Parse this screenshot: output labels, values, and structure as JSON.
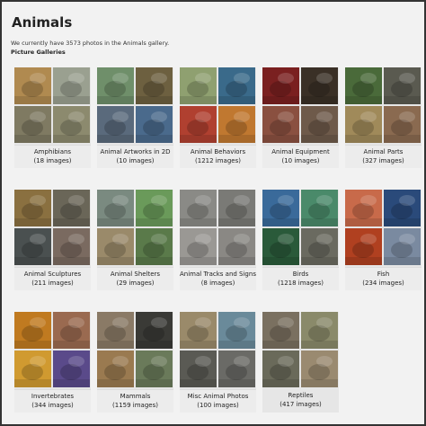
{
  "page": {
    "title": "Animals",
    "intro": "We currently have 3573 photos in the Animals gallery.",
    "section_label": "Picture Galleries"
  },
  "galleries": [
    {
      "name": "Amphibians",
      "count": "(18 images)",
      "colors": [
        "#b08a50",
        "#9aa090",
        "#7f7a62",
        "#8c8a6e"
      ],
      "icons": [
        "frog-photo",
        "frog-photo",
        "frog-photo",
        "frog-photo"
      ]
    },
    {
      "name": "Animal Artworks in 2D",
      "count": "(10 images)",
      "colors": [
        "#6f8f6a",
        "#6d6040",
        "#5a6a7c",
        "#4a6a8c"
      ],
      "icons": [
        "art-photo",
        "art-photo",
        "art-photo",
        "art-photo"
      ]
    },
    {
      "name": "Animal Behaviors",
      "count": "(1212 images)",
      "colors": [
        "#8fa070",
        "#3a6a8a",
        "#b04030",
        "#c07830"
      ],
      "icons": [
        "animal-photo",
        "animal-photo",
        "animal-photo",
        "animal-photo"
      ]
    },
    {
      "name": "Animal Equipment",
      "count": "(10 images)",
      "colors": [
        "#7a2020",
        "#3a3026",
        "#8a5040",
        "#6e5a4a"
      ],
      "icons": [
        "equipment-photo",
        "equipment-photo",
        "equipment-photo",
        "equipment-photo"
      ]
    },
    {
      "name": "Animal Parts",
      "count": "(327 images)",
      "colors": [
        "#4a6a3a",
        "#5a5a50",
        "#a08a5a",
        "#8a6a50"
      ],
      "icons": [
        "animal-photo",
        "animal-photo",
        "animal-photo",
        "animal-photo"
      ]
    },
    {
      "name": "Animal Sculptures",
      "count": "(211 images)",
      "colors": [
        "#8a7040",
        "#6a6658",
        "#4a5050",
        "#7a6a60"
      ],
      "icons": [
        "sculpture-photo",
        "sculpture-photo",
        "sculpture-photo",
        "sculpture-photo"
      ]
    },
    {
      "name": "Animal Shelters",
      "count": "(29 images)",
      "colors": [
        "#7a8a80",
        "#6a9a5a",
        "#9a8a6a",
        "#5a7a4a"
      ],
      "icons": [
        "shelter-photo",
        "shelter-photo",
        "shelter-photo",
        "shelter-photo"
      ]
    },
    {
      "name": "Animal Tracks and Signs",
      "count": "(8 images)",
      "colors": [
        "#8a8a86",
        "#7a7a76",
        "#9a9894",
        "#8a8884"
      ],
      "icons": [
        "tracks-photo",
        "tracks-photo",
        "tracks-photo",
        "tracks-photo"
      ]
    },
    {
      "name": "Birds",
      "count": "(1218 images)",
      "colors": [
        "#3a6a9a",
        "#4a8a6a",
        "#2a5a3a",
        "#6a6a60"
      ],
      "icons": [
        "bird-photo",
        "bird-photo",
        "bird-photo",
        "bird-photo"
      ]
    },
    {
      "name": "Fish",
      "count": "(234 images)",
      "colors": [
        "#c86a4a",
        "#2a4a7a",
        "#b04020",
        "#7a8aa0"
      ],
      "icons": [
        "fish-photo",
        "fish-photo",
        "fish-photo",
        "fish-photo"
      ]
    },
    {
      "name": "Invertebrates",
      "count": "(344 images)",
      "colors": [
        "#c07a20",
        "#9a6a50",
        "#d09a30",
        "#5a4a8a"
      ],
      "icons": [
        "bug-photo",
        "bug-photo",
        "bug-photo",
        "bug-photo"
      ]
    },
    {
      "name": "Mammals",
      "count": "(1159 images)",
      "colors": [
        "#8a7a66",
        "#3a3a36",
        "#9a7a50",
        "#6a7a5a"
      ],
      "icons": [
        "mammal-photo",
        "mammal-photo",
        "mammal-photo",
        "mammal-photo"
      ]
    },
    {
      "name": "Misc Animal Photos",
      "count": "(100 images)",
      "colors": [
        "#9a8a6a",
        "#6a8a9a",
        "#5a5a54",
        "#6a6a66"
      ],
      "icons": [
        "misc-photo",
        "misc-photo",
        "misc-photo",
        "misc-photo"
      ]
    },
    {
      "name": "Reptiles",
      "count": "(417 images)",
      "colors": [
        "#7a7060",
        "#8a8a6a",
        "#6a6a5a",
        "#9a8a70"
      ],
      "icons": [
        "reptile-photo",
        "reptile-photo",
        "reptile-photo",
        "reptile-photo"
      ]
    }
  ]
}
